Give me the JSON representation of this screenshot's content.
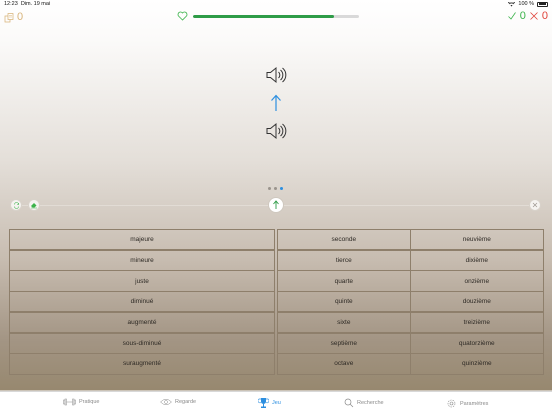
{
  "status_bar": {
    "time": "12:23",
    "date": "Dim. 19 mai",
    "battery_percent": "100 %"
  },
  "top_bar": {
    "coins": "0",
    "progress": 0.85,
    "correct_count": "0",
    "wrong_count": "0"
  },
  "page_indicator": {
    "count": 3,
    "active_index": 2
  },
  "left_options": [
    "majeure",
    "mineure",
    "juste",
    "diminué",
    "augmenté",
    "sous-diminué",
    "suraugmenté"
  ],
  "right_options": [
    [
      "seconde",
      "neuvième"
    ],
    [
      "tierce",
      "dixième"
    ],
    [
      "quarte",
      "onzième"
    ],
    [
      "quinte",
      "douzième"
    ],
    [
      "sixte",
      "treizième"
    ],
    [
      "septième",
      "quatorzième"
    ],
    [
      "octave",
      "quinzième"
    ]
  ],
  "tabs": [
    {
      "label": "Pratique",
      "icon": "dumbbell-icon"
    },
    {
      "label": "Regarde",
      "icon": "eye-icon"
    },
    {
      "label": "Jeu",
      "icon": "trophy-icon"
    },
    {
      "label": "Recherche",
      "icon": "search-icon"
    },
    {
      "label": "Paramètres",
      "icon": "gear-icon"
    }
  ],
  "colors": {
    "accent": "#2d8fe0",
    "progress": "#2e9c47",
    "correct": "#3bb34a",
    "wrong": "#e0433a",
    "coin": "#d8b47a"
  }
}
